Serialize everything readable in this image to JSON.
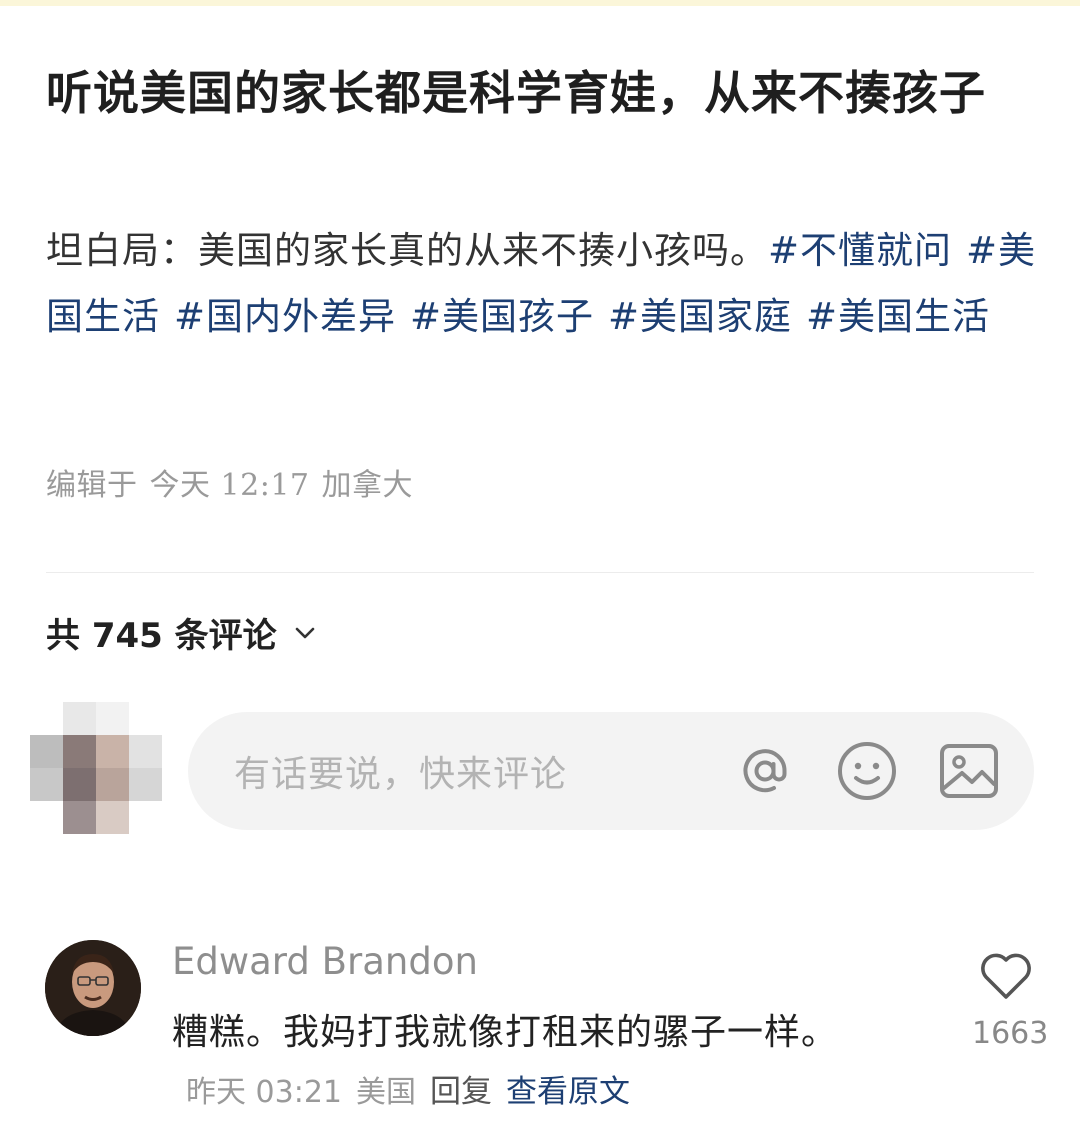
{
  "post": {
    "title": "听说美国的家长都是科学育娃，从来不揍孩子",
    "body": "坦白局：美国的家长真的从来不揍小孩吗。",
    "tags": [
      "#不懂就问",
      "#美国生活",
      "#国内外差异",
      "#美国孩子",
      "#美国家庭",
      "#美国生活"
    ],
    "edited_label": "编辑于",
    "edited_time": "今天 12:17",
    "location": "加拿大"
  },
  "comments_header": {
    "label": "共 745 条评论"
  },
  "comment_input": {
    "placeholder": "有话要说，快来评论",
    "icons": [
      "at-icon",
      "emoji-icon",
      "image-icon"
    ]
  },
  "comment": {
    "author": "Edward Brandon",
    "text": "糟糕。我妈打我就像打租来的骡子一样。",
    "time": "昨天 03:21",
    "location": "美国",
    "reply_label": "回复",
    "view_original_label": "查看原文",
    "likes": "1663"
  },
  "colors": {
    "tag": "#1d3f73",
    "meta": "#9a9a9a",
    "input_bg": "#f3f3f3"
  }
}
